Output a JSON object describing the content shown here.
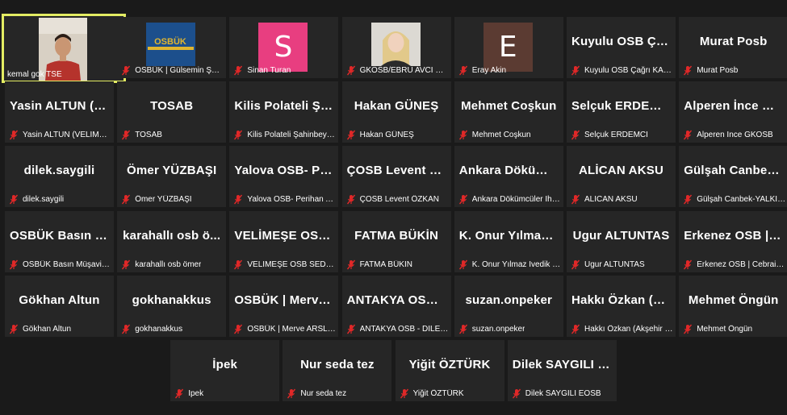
{
  "colors": {
    "background": "#1a1a1a",
    "tile": "#262626",
    "speaking_border": "#e3ec63",
    "mute_red": "#e02828"
  },
  "speaker": {
    "name": "kemal gok TSE"
  },
  "participants": [
    {
      "big": "",
      "small": "OSBÜK | Gülsemin ŞENEL...",
      "avatar": "logo",
      "logo_text": "OSBÜK"
    },
    {
      "big": "",
      "small": "Sinan Turan",
      "avatar": "letter",
      "letter": "S",
      "avatar_color": "#e83e80"
    },
    {
      "big": "",
      "small": "GKOSB/EBRU AVCI KAPL...",
      "avatar": "photo"
    },
    {
      "big": "",
      "small": "Eray Akin",
      "avatar": "letter",
      "letter": "E",
      "avatar_color": "#5b3b32"
    },
    {
      "big": "Kuyulu OSB Çağ...",
      "small": "Kuyulu OSB Çağrı KARAK..."
    },
    {
      "big": "Murat Posb",
      "small": "Murat Posb"
    },
    {
      "big": "Yasin ALTUN (V...",
      "small": "Yasin ALTUN (VELİMEŞE ..."
    },
    {
      "big": "TOSAB",
      "small": "TOSAB"
    },
    {
      "big": "Kilis Polateli Şa...",
      "small": "Kilis Polateli Şahinbey OS..."
    },
    {
      "big": "Hakan GÜNEŞ",
      "small": "Hakan GÜNEŞ"
    },
    {
      "big": "Mehmet Coşkun",
      "small": "Mehmet Coşkun"
    },
    {
      "big": "Selçuk ERDEMCİ",
      "small": "Selçuk ERDEMCİ"
    },
    {
      "big": "Alperen İnce GK...",
      "small": "Alperen İnce GKOSB"
    },
    {
      "big": "dilek.saygili",
      "small": "dilek.saygili"
    },
    {
      "big": "Ömer YÜZBAŞI",
      "small": "Ömer YÜZBAŞI"
    },
    {
      "big": "Yalova OSB- Per...",
      "small": "Yalova OSB- Perihan Ayık"
    },
    {
      "big": "ÇOSB Levent ÖZ...",
      "small": "ÇOSB Levent ÖZKAN"
    },
    {
      "big": "Ankara Dökümc...",
      "small": "Ankara Dökümcüler İhtisa..."
    },
    {
      "big": "ALİCAN AKSU",
      "small": "ALİCAN AKSU"
    },
    {
      "big": "Gülşah Canbek-...",
      "small": "Gülşah Canbek-YALKİM O..."
    },
    {
      "big": "OSBÜK Basın M...",
      "small": "OSBÜK Basın Müşavirliği"
    },
    {
      "big": "karahallı osb ö...",
      "small": "karahallı osb ömer"
    },
    {
      "big": "VELİMEŞE OSB...",
      "small": "VELİMEŞE OSB SEDA OK..."
    },
    {
      "big": "FATMA BÜKİN",
      "small": "FATMA BÜKİN"
    },
    {
      "big": "K. Onur Yılmaz İ...",
      "small": "K. Onur Yılmaz İvedik Osb"
    },
    {
      "big": "Ugur ALTUNTAS",
      "small": "Ugur ALTUNTAS"
    },
    {
      "big": "Erkenez OSB | C...",
      "small": "Erkenez OSB | Cebrail Gö..."
    },
    {
      "big": "Gökhan Altun",
      "small": "Gökhan Altun"
    },
    {
      "big": "gokhanakkus",
      "small": "gokhanakkus"
    },
    {
      "big": "OSBÜK | Merve...",
      "small": "OSBÜK | Merve ARSLAN"
    },
    {
      "big": "ANTAKYA OSB -...",
      "small": "ANTAKYA OSB - DİLEK Yİ..."
    },
    {
      "big": "suzan.onpeker",
      "small": "suzan.onpeker"
    },
    {
      "big": "Hakkı Özkan (A...",
      "small": "Hakkı Özkan (Akşehir OSB)"
    },
    {
      "big": "Mehmet Öngün",
      "small": "Mehmet Öngün"
    },
    {
      "big": "İpek",
      "small": "İpek"
    },
    {
      "big": "Nur seda tez",
      "small": "Nur seda tez"
    },
    {
      "big": "Yiğit ÖZTÜRK",
      "small": "Yiğit ÖZTÜRK"
    },
    {
      "big": "Dilek SAYGILI E...",
      "small": "Dilek SAYGILI EOSB"
    }
  ]
}
